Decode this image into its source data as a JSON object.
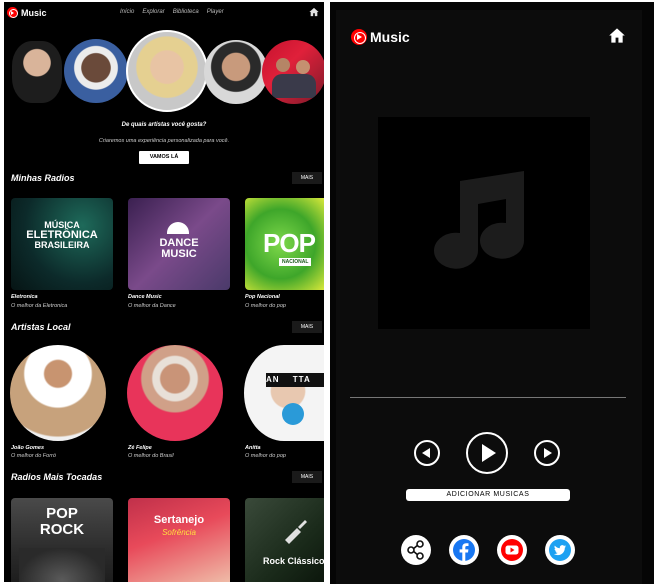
{
  "left_app": {
    "brand": "Music",
    "nav": [
      "Início",
      "Explorar",
      "Biblioteca",
      "Player"
    ],
    "onboarding": {
      "question": "De quais artistas você gosta?",
      "subtitle": "Criaremos uma experiência personalizada para você.",
      "cta": "VAMOS LÁ"
    },
    "sections": {
      "radios": {
        "title": "Minhas Radios",
        "more": "MAIS",
        "cards": [
          {
            "title": "Eletronica",
            "subtitle": "O melhor da Eletronica",
            "art": [
              "MÚSICA",
              "ELETRÔNICA",
              "BRASILEIRA"
            ]
          },
          {
            "title": "Dance Music",
            "subtitle": "O melhor da Dance",
            "art": [
              "DANCE",
              "MUSIC"
            ]
          },
          {
            "title": "Pop Nacional",
            "subtitle": "O melhor do pop",
            "art": [
              "POP",
              "NACIONAL"
            ]
          }
        ]
      },
      "local": {
        "title": "Artistas Local",
        "more": "MAIS",
        "artists": [
          {
            "title": "João Gomes",
            "subtitle": "O melhor do Forró"
          },
          {
            "title": "Zé Felipe",
            "subtitle": "O melhor do Brasil"
          },
          {
            "title": "Anitta",
            "subtitle": "O melhor do pop"
          }
        ],
        "anitta_art": [
          "AN",
          "TTA"
        ]
      },
      "top": {
        "title": "Radios Mais Tocadas",
        "more": "MAIS",
        "cards": [
          {
            "art": [
              "POP",
              "ROCK"
            ]
          },
          {
            "art": [
              "Sertanejo",
              "Sofrência"
            ]
          },
          {
            "art": [
              "Rock Clássico"
            ]
          }
        ]
      }
    }
  },
  "right_app": {
    "brand": "Music",
    "add_label": "ADICIONAR MUSICAS",
    "social": [
      "share-icon",
      "facebook-icon",
      "youtube-icon",
      "twitter-icon"
    ]
  },
  "colors": {
    "brand_red": "#ff0000",
    "pop_green": "#5bc236",
    "facebook_blue": "#1877f2",
    "twitter_blue": "#1da1f2"
  }
}
